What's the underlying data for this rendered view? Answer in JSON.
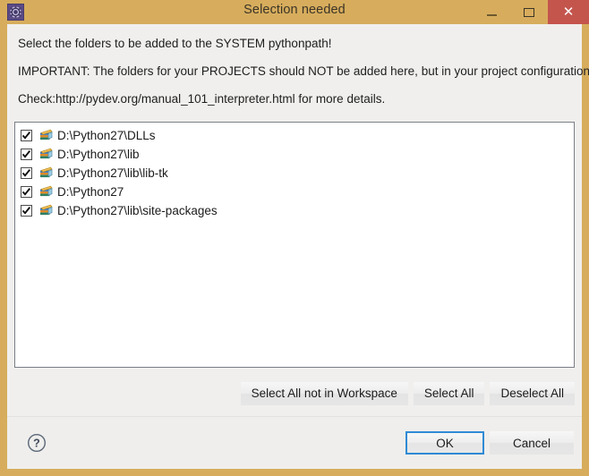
{
  "window": {
    "title": "Selection needed",
    "app_icon": "gear-icon",
    "controls": {
      "minimize": "–",
      "maximize": "□",
      "close": "✕"
    },
    "colors": {
      "frame": "#d7ad5d",
      "close_button": "#c4554d",
      "body": "#f0efed",
      "bottom_bar": "#efeeec",
      "default_button_focus": "#2f8ad4"
    }
  },
  "messages": [
    "Select the folders to be added to the SYSTEM pythonpath!",
    "IMPORTANT: The folders for your PROJECTS should NOT be added here, but in your project configuration.",
    "Check:http://pydev.org/manual_101_interpreter.html for more details."
  ],
  "list": {
    "items": [
      {
        "label": "D:\\Python27\\DLLs",
        "checked": true,
        "icon": "library-folder-icon"
      },
      {
        "label": "D:\\Python27\\lib",
        "checked": true,
        "icon": "library-folder-icon"
      },
      {
        "label": "D:\\Python27\\lib\\lib-tk",
        "checked": true,
        "icon": "library-folder-icon"
      },
      {
        "label": "D:\\Python27",
        "checked": true,
        "icon": "library-folder-icon"
      },
      {
        "label": "D:\\Python27\\lib\\site-packages",
        "checked": true,
        "icon": "library-folder-icon"
      }
    ]
  },
  "mid_buttons": {
    "select_all_not_in_workspace": "Select All not in Workspace",
    "select_all": "Select All",
    "deselect_all": "Deselect All"
  },
  "bottom_bar": {
    "help_icon": "help-circle-icon",
    "ok": "OK",
    "cancel": "Cancel"
  }
}
